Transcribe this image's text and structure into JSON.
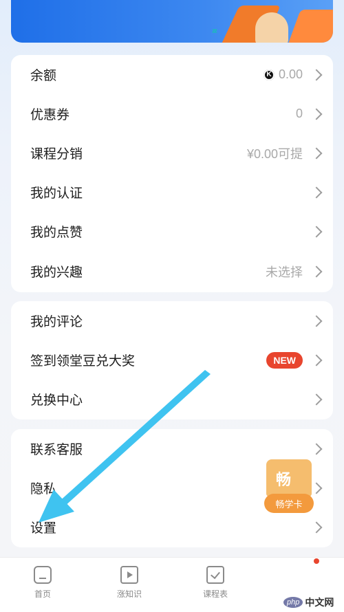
{
  "banner": {
    "mark": "ᶻᶻ"
  },
  "menu_group_1": [
    {
      "label": "余额",
      "value": "0.00",
      "has_coin": true
    },
    {
      "label": "优惠券",
      "value": "0"
    },
    {
      "label": "课程分销",
      "value": "¥0.00可提"
    },
    {
      "label": "我的认证",
      "value": ""
    },
    {
      "label": "我的点赞",
      "value": ""
    },
    {
      "label": "我的兴趣",
      "value": "未选择"
    }
  ],
  "menu_group_2": [
    {
      "label": "我的评论"
    },
    {
      "label": "签到领堂豆兑大奖",
      "badge": "NEW"
    },
    {
      "label": "兑换中心"
    }
  ],
  "menu_group_3": [
    {
      "label": "联系客服"
    },
    {
      "label": "隐私"
    },
    {
      "label": "设置"
    }
  ],
  "coin_symbol": "K",
  "pass_card": {
    "top_char": "畅",
    "label": "畅学卡"
  },
  "tabbar": [
    {
      "label": "首页",
      "icon": "home-icon"
    },
    {
      "label": "涨知识",
      "icon": "play-icon"
    },
    {
      "label": "课程表",
      "icon": "check-icon"
    }
  ],
  "watermark": {
    "php": "php",
    "cn": "中文网"
  },
  "colors": {
    "accent": "#1f6fe8",
    "badge": "#e8452e",
    "pass": "#f39a3d",
    "arrow": "#3fc3f0"
  }
}
